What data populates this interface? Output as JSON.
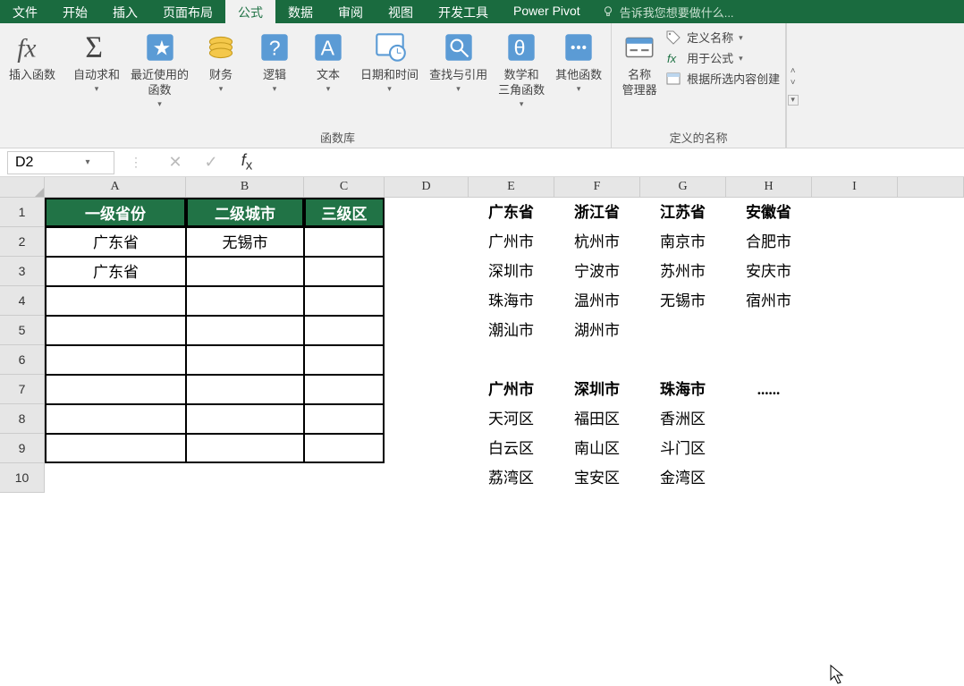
{
  "tabs": {
    "file": "文件",
    "home": "开始",
    "insert": "插入",
    "layout": "页面布局",
    "formulas": "公式",
    "data": "数据",
    "review": "审阅",
    "view": "视图",
    "dev": "开发工具",
    "powerpivot": "Power Pivot",
    "tellme": "告诉我您想要做什么..."
  },
  "ribbon": {
    "insertfn": "插入函数",
    "autosum": "自动求和",
    "recent": "最近使用的\n函数",
    "financial": "财务",
    "logical": "逻辑",
    "text": "文本",
    "datetime": "日期和时间",
    "lookup": "查找与引用",
    "math": "数学和\n三角函数",
    "other": "其他函数",
    "funclib": "函数库",
    "namemgr": "名称\n管理器",
    "definename": "定义名称",
    "useformula": "用于公式",
    "createfrom": "根据所选内容创建",
    "definednames": "定义的名称"
  },
  "namebox": "D2",
  "formula": "",
  "columns": [
    "A",
    "B",
    "C",
    "D",
    "E",
    "F",
    "G",
    "H",
    "I"
  ],
  "rownums": [
    "1",
    "2",
    "3",
    "4",
    "5",
    "6",
    "7",
    "8",
    "9",
    "10"
  ],
  "table": {
    "h1": "一级省份",
    "h2": "二级城市",
    "h3": "三级区",
    "a2": "广东省",
    "b2": "无锡市",
    "a3": "广东省"
  },
  "ref": {
    "e1": "广东省",
    "f1": "浙江省",
    "g1": "江苏省",
    "h1": "安徽省",
    "e2": "广州市",
    "f2": "杭州市",
    "g2": "南京市",
    "h2": "合肥市",
    "e3": "深圳市",
    "f3": "宁波市",
    "g3": "苏州市",
    "h3": "安庆市",
    "e4": "珠海市",
    "f4": "温州市",
    "g4": "无锡市",
    "h4": "宿州市",
    "e5": "潮汕市",
    "f5": "湖州市",
    "e7": "广州市",
    "f7": "深圳市",
    "g7": "珠海市",
    "h7": "......",
    "e8": "天河区",
    "f8": "福田区",
    "g8": "香洲区",
    "e9": "白云区",
    "f9": "南山区",
    "g9": "斗门区",
    "e10": "荔湾区",
    "f10": "宝安区",
    "g10": "金湾区"
  }
}
